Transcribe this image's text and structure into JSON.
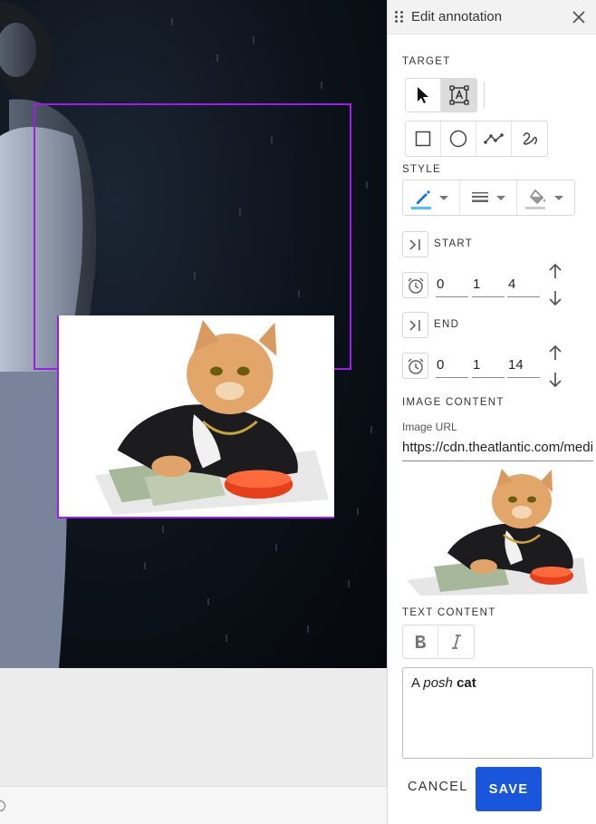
{
  "panel": {
    "title": "Edit annotation",
    "close_icon": "close-icon"
  },
  "target": {
    "label": "TARGET",
    "tools": [
      "pointer-icon",
      "text-frame-icon"
    ],
    "shapes": [
      "rectangle-icon",
      "circle-icon",
      "polyline-icon",
      "freehand-icon"
    ]
  },
  "style": {
    "label": "STYLE",
    "stroke_color": "#4fc3f7",
    "fill_color": "#cccccc"
  },
  "start": {
    "label": "START",
    "h": "0",
    "m": "1",
    "s": "4"
  },
  "end": {
    "label": "END",
    "h": "0",
    "m": "1",
    "s": "14"
  },
  "image_content": {
    "label": "IMAGE CONTENT",
    "url_label": "Image URL",
    "url_value": "https://cdn.theatlantic.com/media"
  },
  "text_content": {
    "label": "TEXT CONTENT",
    "bold_icon": "bold-icon",
    "italic_icon": "italic-icon",
    "text_plain": "A ",
    "text_italic": "posh",
    "text_space": " ",
    "text_bold": "cat"
  },
  "actions": {
    "cancel": "CANCEL",
    "save": "SAVE"
  },
  "colors": {
    "accent": "#1a56db",
    "annotation": "#9b1fe8"
  }
}
